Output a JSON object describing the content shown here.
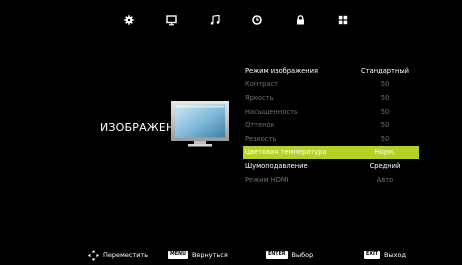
{
  "tabs": [
    {
      "icon": "gear-icon",
      "active": false
    },
    {
      "icon": "monitor-icon",
      "active": true
    },
    {
      "icon": "music-note-icon",
      "active": false
    },
    {
      "icon": "clock-icon",
      "active": false
    },
    {
      "icon": "lock-icon",
      "active": false
    },
    {
      "icon": "apps-grid-icon",
      "active": false
    }
  ],
  "page": {
    "title": "ИЗОБРАЖЕНИЕ",
    "icon": "tv-icon"
  },
  "settings": [
    {
      "label": "Режим изображения",
      "value": "Стандартный",
      "state": "active"
    },
    {
      "label": "Контраст",
      "value": "50",
      "state": "dim"
    },
    {
      "label": "Яркость",
      "value": "50",
      "state": "dim"
    },
    {
      "label": "Насыщенность",
      "value": "50",
      "state": "dim"
    },
    {
      "label": "Оттенок",
      "value": "50",
      "state": "dim"
    },
    {
      "label": "Резкость",
      "value": "50",
      "state": "dim"
    },
    {
      "label": "Цветовая температура",
      "value": "Норм.",
      "state": "selected"
    },
    {
      "label": "Шумоподавление",
      "value": "Средний",
      "state": "active"
    },
    {
      "label": "Режим HDMI",
      "value": "Авто",
      "state": "dim"
    }
  ],
  "footer": {
    "move": "Переместить",
    "menu_key": "MENU",
    "back": "Вернуться",
    "enter_key": "ENTER",
    "select": "Выбор",
    "exit_key": "EXIT",
    "exit": "Выход"
  },
  "colors": {
    "background": "#000000",
    "highlight": "#b4d226",
    "text": "#ffffff",
    "dim_text": "#707070"
  }
}
